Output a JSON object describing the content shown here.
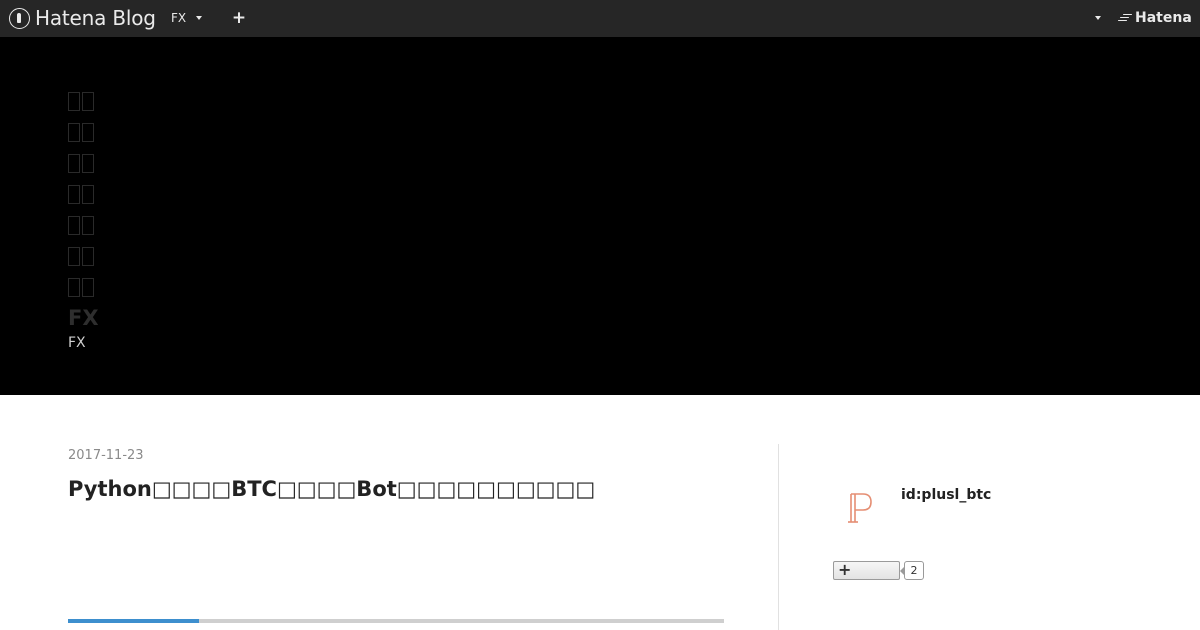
{
  "globalbar": {
    "logo_text": "Hatena Blog",
    "blog_menu_label": "FX",
    "add_icon": "plus-icon",
    "brand_text": "Hatena",
    "background": "#262626"
  },
  "header": {
    "blog_title": "FX",
    "blog_description": "FX",
    "background": "#000000",
    "title_glyph_rows": 7
  },
  "entry": {
    "date": "2017-11-23",
    "title": "Python□□□□BTC□□□□Bot□□□□□□□□□□",
    "reading_progress": 0.2
  },
  "sidebar": {
    "profile_id": "id:plusl_btc",
    "avatar_letter": "ℙ",
    "follow_count": "2",
    "accent": "#3d8fce"
  }
}
